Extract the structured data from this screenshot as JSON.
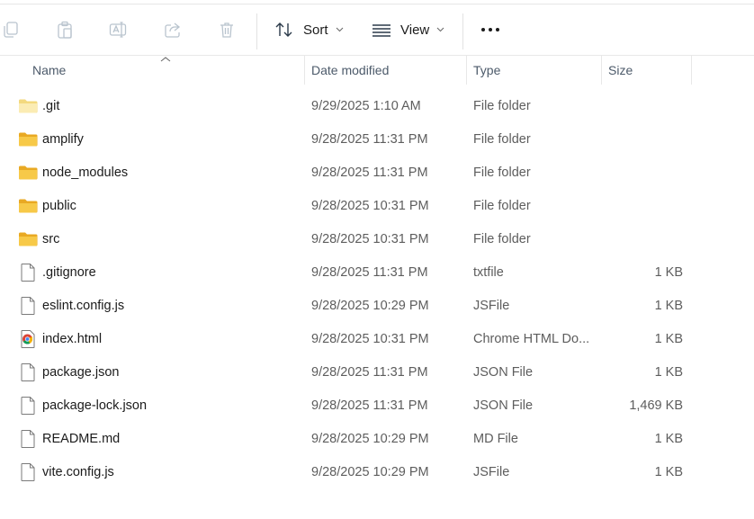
{
  "toolbar": {
    "sort_label": "Sort",
    "view_label": "View",
    "more_label": "•••",
    "icons": [
      "copy-icon",
      "paste-icon",
      "rename-icon",
      "share-icon",
      "delete-icon",
      "sort-icon",
      "view-icon",
      "more-icon"
    ]
  },
  "columns": {
    "name": "Name",
    "date": "Date modified",
    "type": "Type",
    "size": "Size",
    "sorted_by": "name"
  },
  "colors": {
    "folder": "#f4c23a",
    "folder_light": "#fde58a",
    "header_text": "#4c5a6a",
    "detail_text": "#5d5d5d",
    "icon_disabled": "#b9c4ce"
  },
  "files": [
    {
      "name": ".git",
      "date": "9/29/2025 1:10 AM",
      "type": "File folder",
      "size": "",
      "icon": "folder-hidden-icon"
    },
    {
      "name": "amplify",
      "date": "9/28/2025 11:31 PM",
      "type": "File folder",
      "size": "",
      "icon": "folder-icon"
    },
    {
      "name": "node_modules",
      "date": "9/28/2025 11:31 PM",
      "type": "File folder",
      "size": "",
      "icon": "folder-icon"
    },
    {
      "name": "public",
      "date": "9/28/2025 10:31 PM",
      "type": "File folder",
      "size": "",
      "icon": "folder-icon"
    },
    {
      "name": "src",
      "date": "9/28/2025 10:31 PM",
      "type": "File folder",
      "size": "",
      "icon": "folder-icon"
    },
    {
      "name": ".gitignore",
      "date": "9/28/2025 11:31 PM",
      "type": "txtfile",
      "size": "1 KB",
      "icon": "file-icon"
    },
    {
      "name": "eslint.config.js",
      "date": "9/28/2025 10:29 PM",
      "type": "JSFile",
      "size": "1 KB",
      "icon": "file-icon"
    },
    {
      "name": "index.html",
      "date": "9/28/2025 10:31 PM",
      "type": "Chrome HTML Do...",
      "size": "1 KB",
      "icon": "chrome-html-icon"
    },
    {
      "name": "package.json",
      "date": "9/28/2025 11:31 PM",
      "type": "JSON File",
      "size": "1 KB",
      "icon": "file-icon"
    },
    {
      "name": "package-lock.json",
      "date": "9/28/2025 11:31 PM",
      "type": "JSON File",
      "size": "1,469 KB",
      "icon": "file-icon"
    },
    {
      "name": "README.md",
      "date": "9/28/2025 10:29 PM",
      "type": "MD File",
      "size": "1 KB",
      "icon": "file-icon"
    },
    {
      "name": "vite.config.js",
      "date": "9/28/2025 10:29 PM",
      "type": "JSFile",
      "size": "1 KB",
      "icon": "file-icon"
    }
  ]
}
